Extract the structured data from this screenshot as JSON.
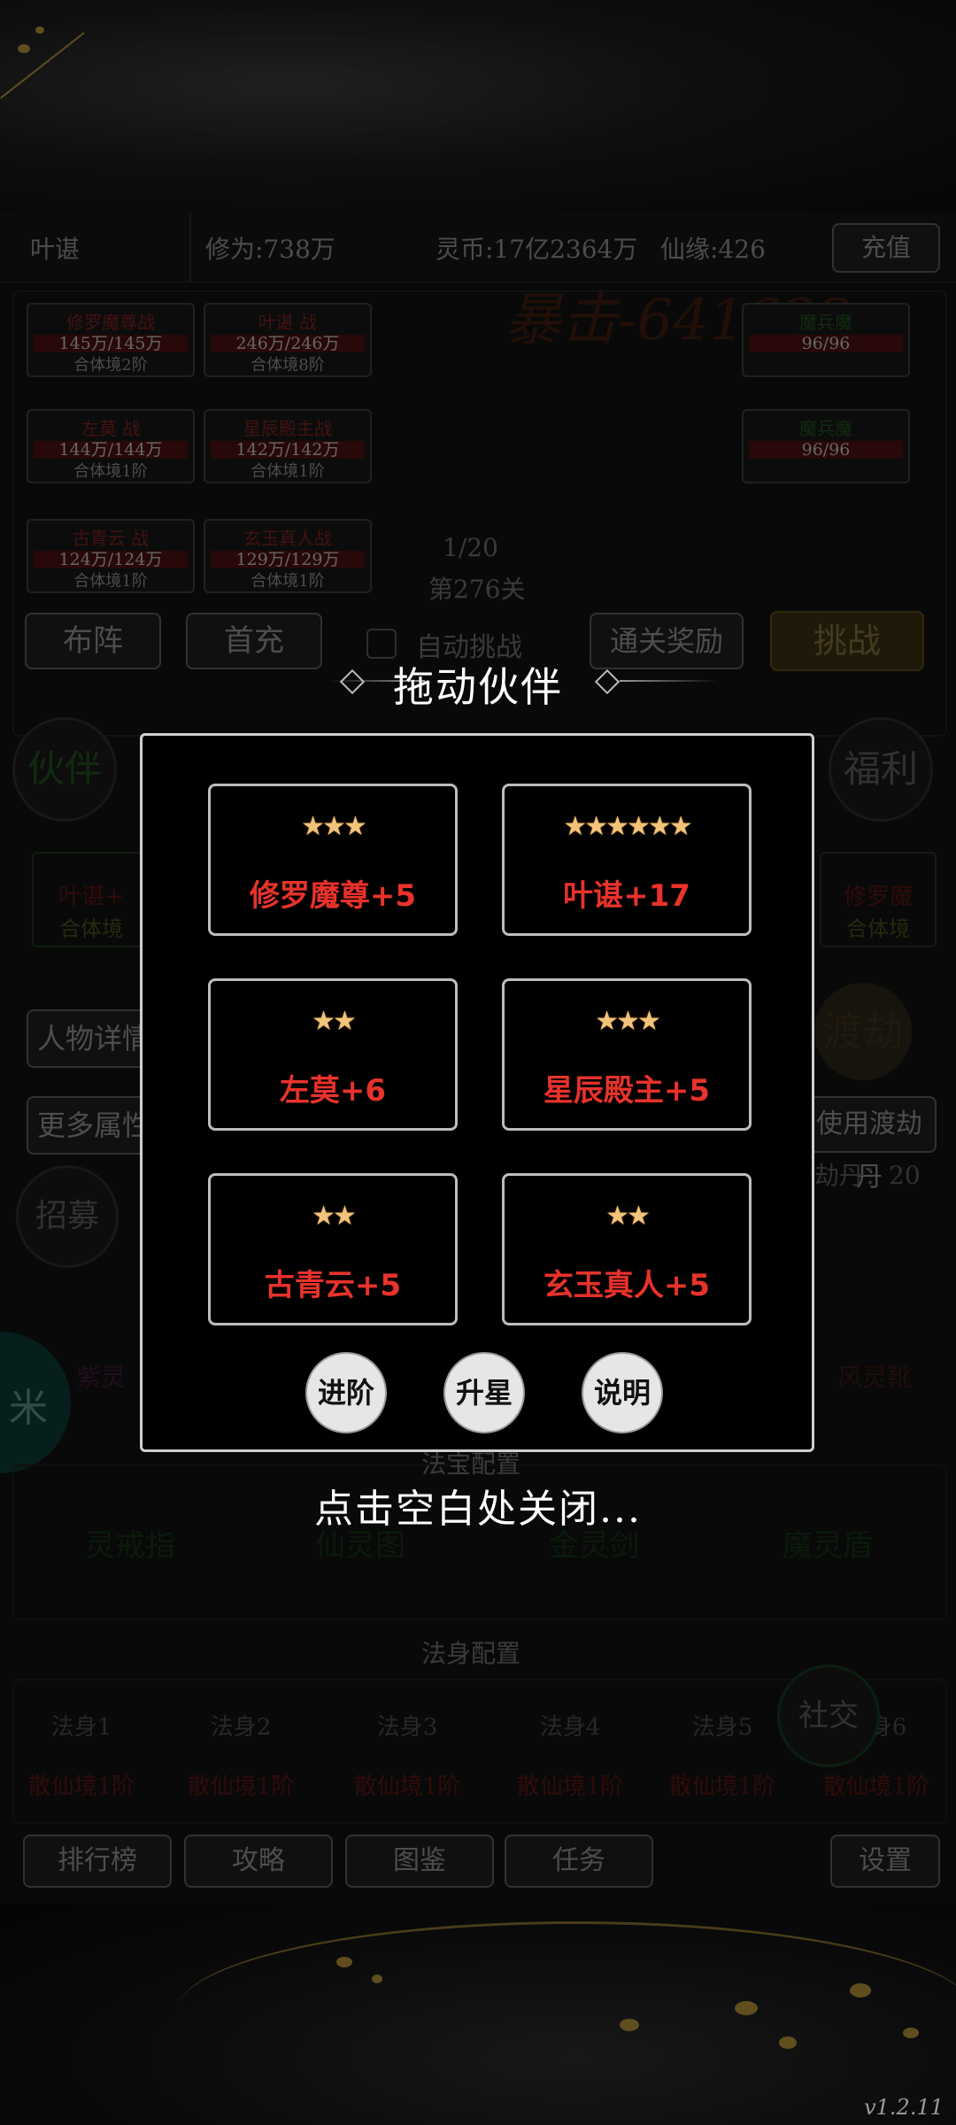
{
  "status_bar": {
    "player_name": "叶谌",
    "cultivation": "修为:738万",
    "spirit_coins": "灵币:17亿2364万",
    "xianyuan": "仙缘:426",
    "recharge_label": "充值"
  },
  "battle": {
    "crit_text": "暴击-641622",
    "allies": [
      {
        "name": "修罗魔尊战",
        "hp": "145万/145万",
        "realm": "合体境2阶"
      },
      {
        "name": "叶谌 战",
        "hp": "246万/246万",
        "realm": "合体境8阶"
      },
      {
        "name": "左莫 战",
        "hp": "144万/144万",
        "realm": "合体境1阶"
      },
      {
        "name": "星辰殿主战",
        "hp": "142万/142万",
        "realm": "合体境1阶"
      },
      {
        "name": "古青云 战",
        "hp": "124万/124万",
        "realm": "合体境1阶"
      },
      {
        "name": "玄玉真人战",
        "hp": "129万/129万",
        "realm": "合体境1阶"
      }
    ],
    "enemies": [
      {
        "name": "魔兵魔",
        "hp": "96/96"
      },
      {
        "name": "魔兵魔",
        "hp": "96/96"
      }
    ],
    "wave": "1/20",
    "stage": "第276关",
    "formation_label": "布阵",
    "first_recharge_label": "首充",
    "auto_battle_label": "自动挑战",
    "clear_reward_label": "通关奖励",
    "challenge_label": "挑战"
  },
  "background_ui": {
    "partner_tab": "伙伴",
    "welfare_tab": "福利",
    "character_details": "人物详情",
    "more_attributes": "更多属性",
    "recruit": "招募",
    "tribulation": "渡劫",
    "use_pill": "使用渡劫丹",
    "pill_count": "渡劫丹：20",
    "left_card": {
      "name": "叶谌+",
      "realm": "合体境"
    },
    "right_card": {
      "name": "修罗魔",
      "realm": "合体境"
    },
    "top_equip_left": "紫灵",
    "top_equip_right": "风灵靴",
    "treasure_title": "法宝配置",
    "treasures": [
      "灵戒指",
      "仙灵图",
      "金灵剑",
      "魔灵盾"
    ],
    "avatar_title": "法身配置",
    "avatars": [
      {
        "name": "法身1",
        "realm": "散仙境1阶"
      },
      {
        "name": "法身2",
        "realm": "散仙境1阶"
      },
      {
        "name": "法身3",
        "realm": "散仙境1阶"
      },
      {
        "name": "法身4",
        "realm": "散仙境1阶"
      },
      {
        "name": "法身5",
        "realm": "散仙境1阶"
      },
      {
        "name": "法身6",
        "realm": "散仙境1阶"
      }
    ],
    "social": "社交",
    "bottom_nav": [
      "排行榜",
      "攻略",
      "图鉴",
      "任务"
    ],
    "settings": "设置"
  },
  "modal": {
    "title": "拖动伙伴",
    "partners": [
      {
        "stars": "★★★",
        "name": "修罗魔尊+5"
      },
      {
        "stars": "★★★★★★",
        "name": "叶谌+17"
      },
      {
        "stars": "★★",
        "name": "左莫+6"
      },
      {
        "stars": "★★★",
        "name": "星辰殿主+5"
      },
      {
        "stars": "★★",
        "name": "古青云+5"
      },
      {
        "stars": "★★",
        "name": "玄玉真人+5"
      }
    ],
    "advance_label": "进阶",
    "star_up_label": "升星",
    "info_label": "说明",
    "close_hint": "点击空白处关闭..."
  },
  "version": "v1.2.11",
  "colors": {
    "partner_name": "#e8322b",
    "star": "#f2c37a",
    "modal_border": "#cfcfcf"
  }
}
